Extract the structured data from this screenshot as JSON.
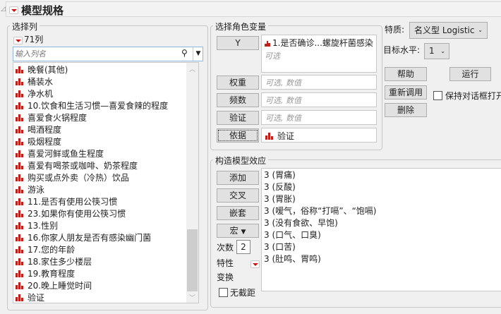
{
  "title": "模型规格",
  "select_columns": {
    "legend": "选择列",
    "count": "71列",
    "search_placeholder": "输入列名",
    "items": [
      "晚餐(其他)",
      "桶装水",
      "净水机",
      "10.饮食和生活习惯—喜爱食辣的程度",
      "喜爱食火锅程度",
      "喝酒程度",
      "吸烟程度",
      "喜爱河鲜或鱼生程度",
      "喜爱有喝茶或咖啡、奶茶程度",
      "购买或点外卖（冷热）饮品",
      "游泳",
      "11.是否有使用公筷习惯",
      "23.如果你有使用公筷习惯",
      "13.性别",
      "16.你家人朋友是否有感染幽门菌",
      "17.您的年龄",
      "18.家住多少楼层",
      "19.教育程度",
      "20.晚上睡觉时间",
      "验证"
    ]
  },
  "roles": {
    "legend": "选择角色变量",
    "y": {
      "label": "Y",
      "value": "1.是否确诊...螺旋杆菌感染",
      "hint": "可选"
    },
    "weight": {
      "label": "权重",
      "hint": "可选, 数值"
    },
    "freq": {
      "label": "频数",
      "hint": "可选, 数值"
    },
    "validation": {
      "label": "验证",
      "hint": "可选, 数值"
    },
    "by": {
      "label": "依据",
      "value": "验证"
    }
  },
  "right": {
    "personality_label": "特质:",
    "personality_value": "名义型 Logistic",
    "target_label": "目标水平:",
    "target_value": "1",
    "help": "帮助",
    "run": "运行",
    "recall": "重新调用",
    "keep_open": "保持对话框打开",
    "remove": "删除"
  },
  "effects": {
    "legend": "构造模型效应",
    "add": "添加",
    "cross": "交叉",
    "nest": "嵌套",
    "macros": "宏",
    "degree_label": "次数",
    "degree": "2",
    "attributes": "特性",
    "transform": "变换",
    "no_intercept": "无截距",
    "items": [
      "3 (胃痛)",
      "3 (反酸)",
      "3 (胃胀)",
      "3 (嗳气，俗称“打嗝”、“饱嗝)",
      "3 (没有食欲、早饱)",
      "3 (口气、口臭)",
      "3 (口苦)",
      "3 (肚鸣、胃鸣)"
    ]
  }
}
